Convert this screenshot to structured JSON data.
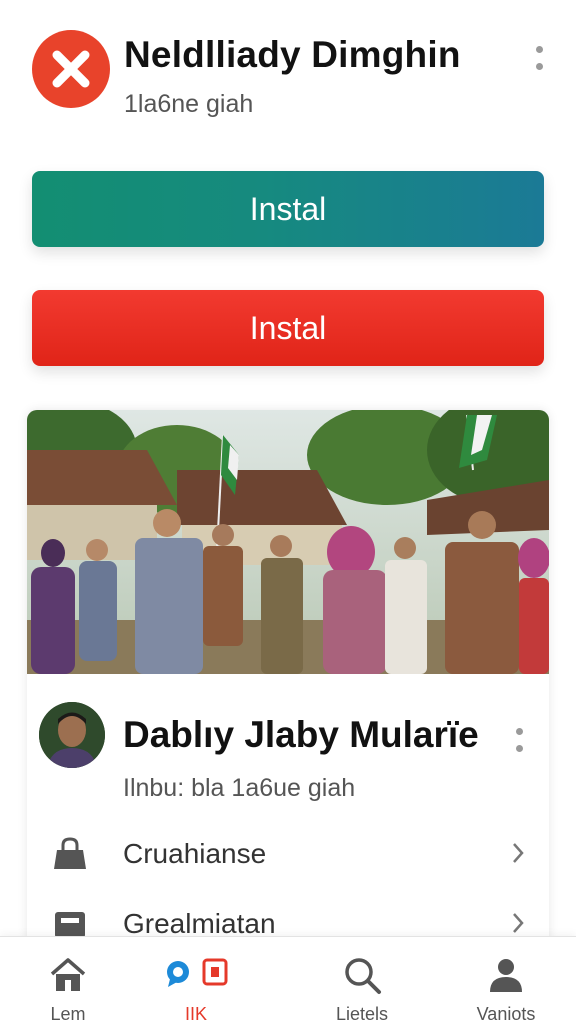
{
  "app": {
    "icon": "close-x-icon",
    "title": "Neldlliady Dimghin",
    "subtitle": "1la6ne giah",
    "accent_red": "#e8432b"
  },
  "buttons": {
    "install_primary": "Instal",
    "install_secondary": "Instal",
    "primary_color": "#148c7a",
    "secondary_color": "#ea2d22"
  },
  "post": {
    "title": "Dablıy Jlaby Mularïe",
    "subtitle": "Ilnbu: bla 1a6ue giah",
    "rows": [
      {
        "icon": "bag-icon",
        "label": "Cruahianse"
      },
      {
        "icon": "printer-icon",
        "label": "Grealmiatan"
      }
    ]
  },
  "nav": {
    "items": [
      {
        "icon": "home-icon",
        "label": "Lem"
      },
      {
        "icon": "chat-bubbles-icon",
        "label": "IIK"
      },
      {
        "icon": "search-icon",
        "label": "Lietels"
      },
      {
        "icon": "profile-icon",
        "label": "Vaniots"
      }
    ]
  }
}
